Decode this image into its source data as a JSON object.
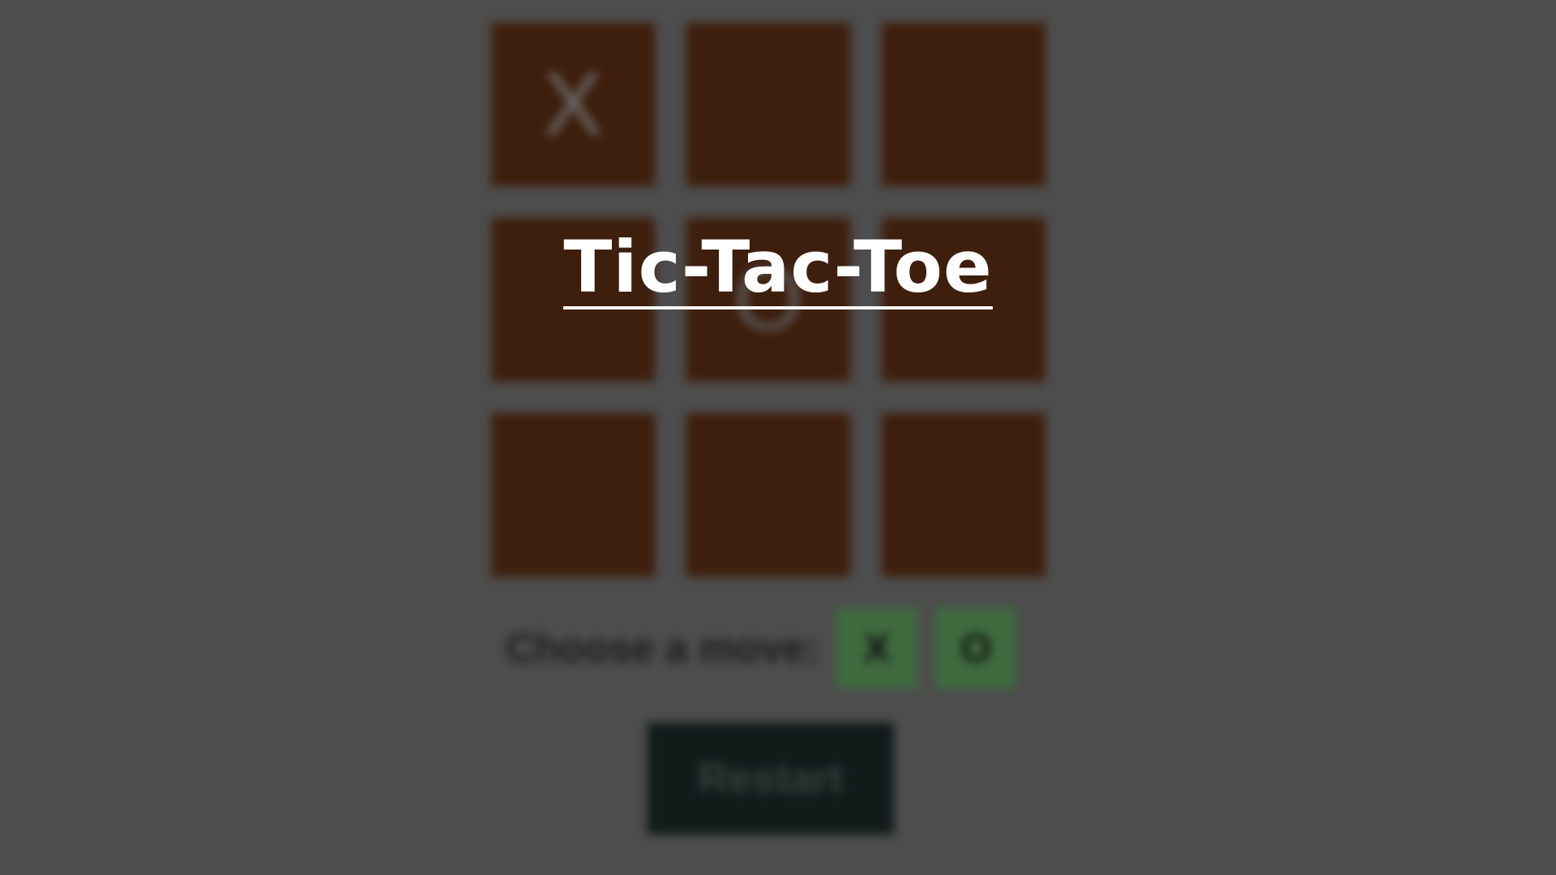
{
  "title": "Tic-Tac-Toe",
  "board": {
    "cells": [
      "X",
      "",
      "",
      "",
      "O",
      "",
      "",
      "",
      ""
    ]
  },
  "move_prompt": {
    "label": "Choose a move:",
    "options": [
      "X",
      "O"
    ]
  },
  "restart_label": "Restart",
  "colors": {
    "background": "#4d4d4d",
    "cell": "#3e1e0c",
    "move_button": "#3f6b3f",
    "restart_button": "#111b1a",
    "title": "#ffffff"
  }
}
